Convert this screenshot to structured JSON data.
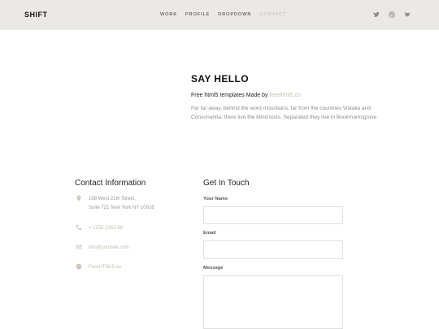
{
  "header": {
    "logo": "SHIFT",
    "nav": [
      "WORK",
      "PROFILE",
      "DROPDOWN",
      "CONTACT"
    ],
    "active_nav": "CONTACT",
    "social_icons": [
      "twitter-icon",
      "dribbble-icon",
      "github-icon"
    ]
  },
  "hero": {
    "title": "SAY HELLO",
    "subtitle_prefix": "Free html5 templates Made by ",
    "subtitle_link": "freehtml5.co",
    "body": "Far far away, behind the word mountains, far from the countries Vokalia and Consonantia, there live the blind texts. Separated they live in Bookmarksgrove"
  },
  "contact_info": {
    "title": "Contact Information",
    "address_line1": "198 West 21th Street,",
    "address_line2": "Suite 721 New York NY 10016",
    "phone": "+ 1235 2355 98",
    "email": "info@yoursite.com",
    "website": "FreeHTML5.co"
  },
  "form": {
    "title": "Get In Touch",
    "name_label": "Your Name",
    "name_value": "",
    "email_label": "Email",
    "email_value": "",
    "message_label": "Message",
    "message_value": ""
  },
  "colors": {
    "header_bg": "#ebe9e5",
    "accent": "#c5bdb1",
    "muted_text": "#999999"
  }
}
